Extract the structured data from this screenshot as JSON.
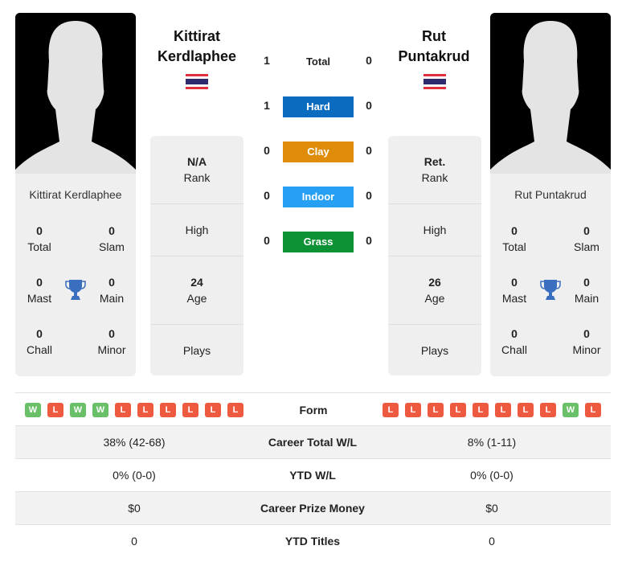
{
  "player1": {
    "name_line1": "Kittirat",
    "name_line2": "Kerdlaphee",
    "full_name": "Kittirat Kerdlaphee",
    "flag": "thailand-flag",
    "titles": {
      "total": "0",
      "slam": "0",
      "mast": "0",
      "main": "0",
      "chall": "0",
      "minor": "0"
    },
    "rank_value": "N/A",
    "high_value": "",
    "age_value": "24",
    "plays_value": "",
    "form": [
      "W",
      "L",
      "W",
      "W",
      "L",
      "L",
      "L",
      "L",
      "L",
      "L"
    ],
    "career_wl": "38% (42-68)",
    "ytd_wl": "0% (0-0)",
    "prize_money": "$0",
    "ytd_titles": "0"
  },
  "player2": {
    "name_line1": "Rut",
    "name_line2": "Puntakrud",
    "full_name": "Rut Puntakrud",
    "flag": "thailand-flag",
    "titles": {
      "total": "0",
      "slam": "0",
      "mast": "0",
      "main": "0",
      "chall": "0",
      "minor": "0"
    },
    "rank_value": "Ret.",
    "high_value": "",
    "age_value": "26",
    "plays_value": "",
    "form": [
      "L",
      "L",
      "L",
      "L",
      "L",
      "L",
      "L",
      "L",
      "W",
      "L"
    ],
    "career_wl": "8% (1-11)",
    "ytd_wl": "0% (0-0)",
    "prize_money": "$0",
    "ytd_titles": "0"
  },
  "labels": {
    "total": "Total",
    "slam": "Slam",
    "mast": "Mast",
    "main": "Main",
    "chall": "Chall",
    "minor": "Minor",
    "rank": "Rank",
    "high": "High",
    "age": "Age",
    "plays": "Plays",
    "form": "Form",
    "career_wl": "Career Total W/L",
    "ytd_wl": "YTD W/L",
    "prize_money": "Career Prize Money",
    "ytd_titles": "YTD Titles"
  },
  "h2h": {
    "total": {
      "label": "Total",
      "p1": "1",
      "p2": "0"
    },
    "surfaces": [
      {
        "label": "Hard",
        "p1": "1",
        "p2": "0",
        "color": "#0a6bbf"
      },
      {
        "label": "Clay",
        "p1": "0",
        "p2": "0",
        "color": "#de8c0a"
      },
      {
        "label": "Indoor",
        "p1": "0",
        "p2": "0",
        "color": "#279ff2"
      },
      {
        "label": "Grass",
        "p1": "0",
        "p2": "0",
        "color": "#0d9135"
      }
    ]
  },
  "colors": {
    "win": "#6abf69",
    "loss": "#ee5a3f",
    "trophy": "#3a6fc0"
  }
}
